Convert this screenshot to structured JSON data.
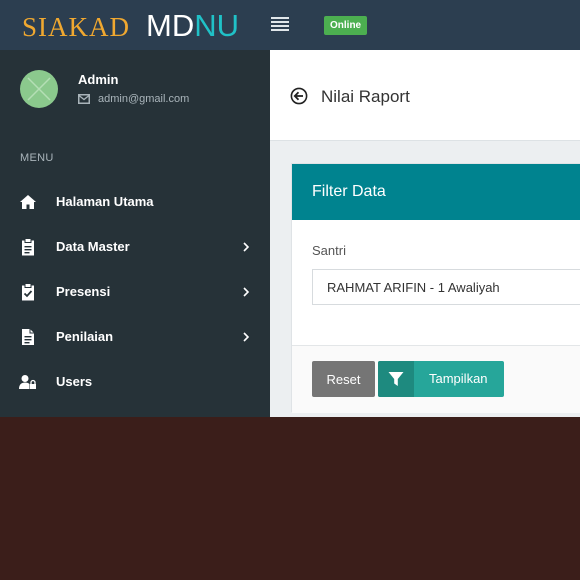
{
  "header": {
    "brand_part1": "SIAKAD",
    "brand_part2": "MD",
    "brand_part3": "NU",
    "status_badge": "Online"
  },
  "user": {
    "name": "Admin",
    "email": "admin@gmail.com"
  },
  "sidebar": {
    "menu_title": "MENU",
    "items": [
      {
        "label": "Halaman Utama",
        "icon": "home-icon",
        "has_submenu": false
      },
      {
        "label": "Data Master",
        "icon": "clipboard-icon",
        "has_submenu": true
      },
      {
        "label": "Presensi",
        "icon": "checklist-icon",
        "has_submenu": true
      },
      {
        "label": "Penilaian",
        "icon": "document-icon",
        "has_submenu": true
      },
      {
        "label": "Users",
        "icon": "user-lock-icon",
        "has_submenu": false
      }
    ]
  },
  "page": {
    "title": "Nilai Raport"
  },
  "filter": {
    "title": "Filter Data",
    "santri_label": "Santri",
    "santri_value": "RAHMAT ARIFIN - 1 Awaliyah",
    "reset_label": "Reset",
    "show_label": "Tampilkan"
  },
  "colors": {
    "topbar": "#2c3e50",
    "sidebar": "#263238",
    "card_header": "#00838f",
    "online_badge": "#4caf50",
    "show_button": "#26a69a",
    "reset_button": "#757575",
    "brand_siakad": "#f0a830",
    "brand_nu": "#20c1c7"
  }
}
